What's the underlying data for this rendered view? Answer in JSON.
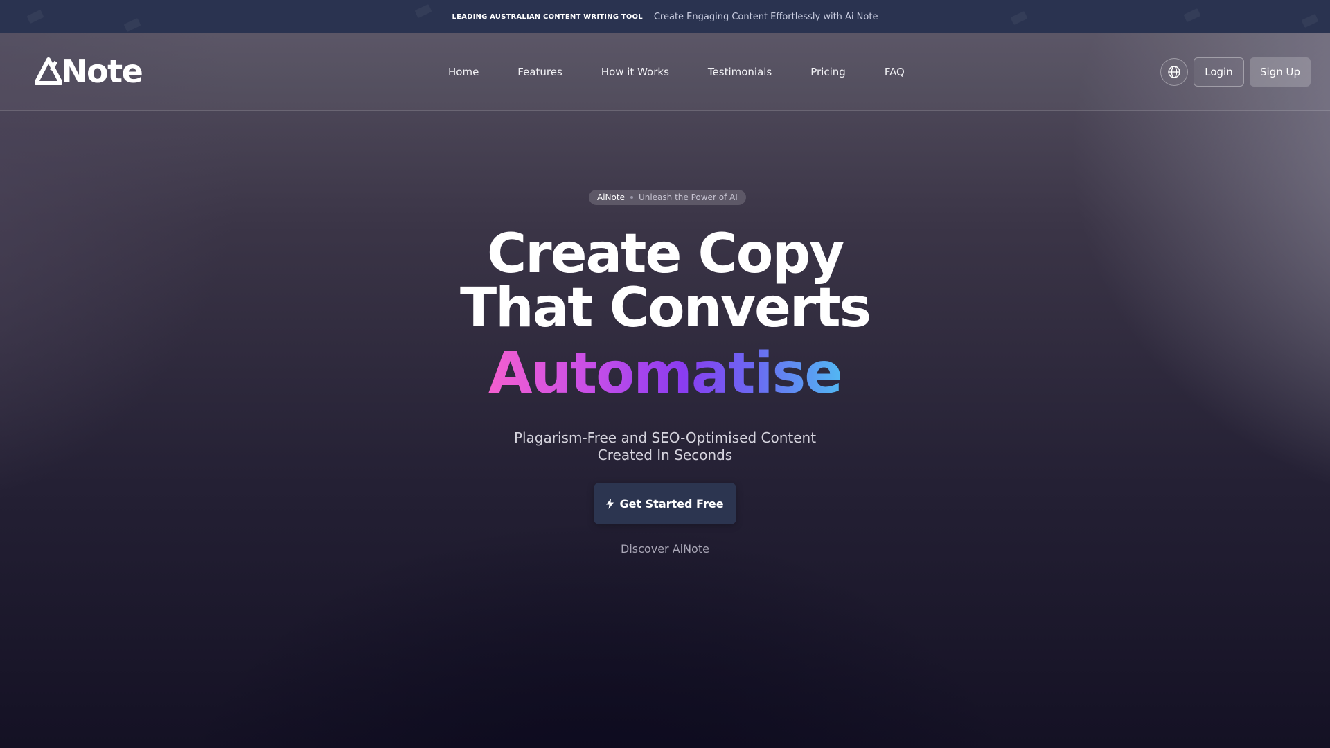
{
  "announcement": {
    "lead": "LEADING AUSTRALIAN CONTENT WRITING TOOL",
    "message": "Create Engaging Content Effortlessly with Ai Note"
  },
  "header": {
    "logo_text": "Note",
    "logo_mark": "Ai",
    "nav": [
      "Home",
      "Features",
      "How it Works",
      "Testimonials",
      "Pricing",
      "FAQ"
    ],
    "language_icon": "globe-icon",
    "login_label": "Login",
    "signup_label": "Sign Up"
  },
  "hero": {
    "badge_brand": "AiNote",
    "badge_tagline": "Unleash the Power of AI",
    "headline_line1": "Create Copy",
    "headline_line2": "That Converts",
    "highlight_word": "Automatise",
    "subtitle_line1": "Plagarism-Free and SEO-Optimised Content",
    "subtitle_line2": "Created In Seconds",
    "cta_label": "Get Started Free",
    "cta_icon": "lightning-icon",
    "secondary_link": "Discover AiNote"
  },
  "colors": {
    "announcement_bg": "#2a3350",
    "cta_bg": "#2c3550",
    "gradient_start": "#f45fcf",
    "gradient_mid": "#8a3cf0",
    "gradient_end": "#52b7f2"
  }
}
